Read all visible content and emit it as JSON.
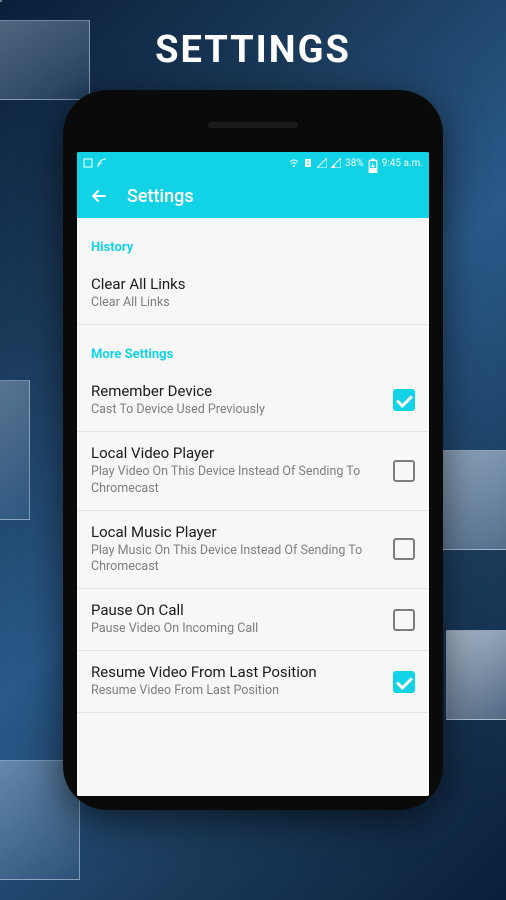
{
  "pageTitle": "SETTINGS",
  "statusbar": {
    "battery": "38%",
    "time": "9:45 a.m."
  },
  "appbar": {
    "title": "Settings"
  },
  "sections": {
    "history": {
      "header": "History",
      "clearAllLinks": {
        "title": "Clear All Links",
        "sub": "Clear All Links"
      }
    },
    "moreSettings": {
      "header": "More Settings",
      "rememberDevice": {
        "title": "Remember Device",
        "sub": "Cast To Device Used Previously",
        "checked": true
      },
      "localVideoPlayer": {
        "title": "Local Video Player",
        "sub": "Play Video On This Device Instead Of Sending To Chromecast",
        "checked": false
      },
      "localMusicPlayer": {
        "title": "Local Music Player",
        "sub": "Play Music On This Device Instead Of Sending To Chromecast",
        "checked": false
      },
      "pauseOnCall": {
        "title": "Pause On Call",
        "sub": "Pause Video On Incoming Call",
        "checked": false
      },
      "resumeVideo": {
        "title": "Resume Video From Last Position",
        "sub": "Resume Video From Last Position",
        "checked": true
      }
    }
  }
}
